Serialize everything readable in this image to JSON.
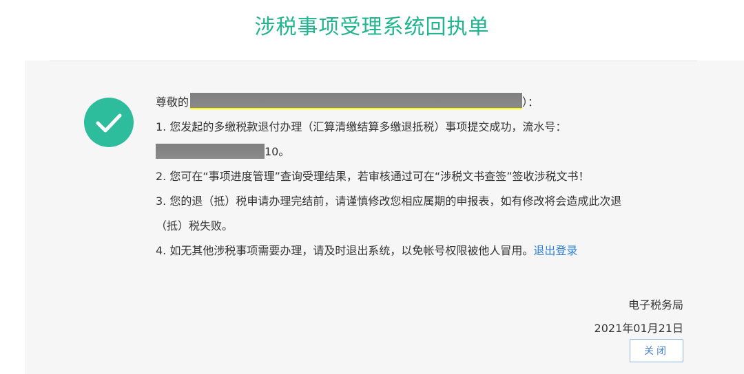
{
  "title": "涉税事项受理系统回执单",
  "greeting_prefix": "尊敬的",
  "greeting_suffix": "）：",
  "items": {
    "line1": "1. 您发起的多缴税款退付办理（汇算清缴结算多缴退抵税）事项提交成功，流水号：",
    "serial_tail": "10。",
    "line2": "2. 您可在“事项进度管理”查询受理结果，若审核通过可在“涉税文书查签”签收涉税文书！",
    "line3a": "3. 您的退（抵）税申请办理完结前，请谨慎修改您相应属期的申报表，如有修改将会造成此次退",
    "line3b": "（抵）税失败。",
    "line4": "4. 如无其他涉税事项需要办理，请及时退出系统，以免帐号权限被他人冒用。",
    "logout_link": "退出登录"
  },
  "footer": {
    "issuer": "电子税务局",
    "date": "2021年01月21日"
  },
  "buttons": {
    "close": "关闭"
  },
  "colors": {
    "title": "#21b58f",
    "check_circle": "#2dbd9d",
    "link": "#2f7fd6",
    "redaction": "#808080"
  },
  "icons": {
    "status": "checkmark-circle-icon"
  }
}
